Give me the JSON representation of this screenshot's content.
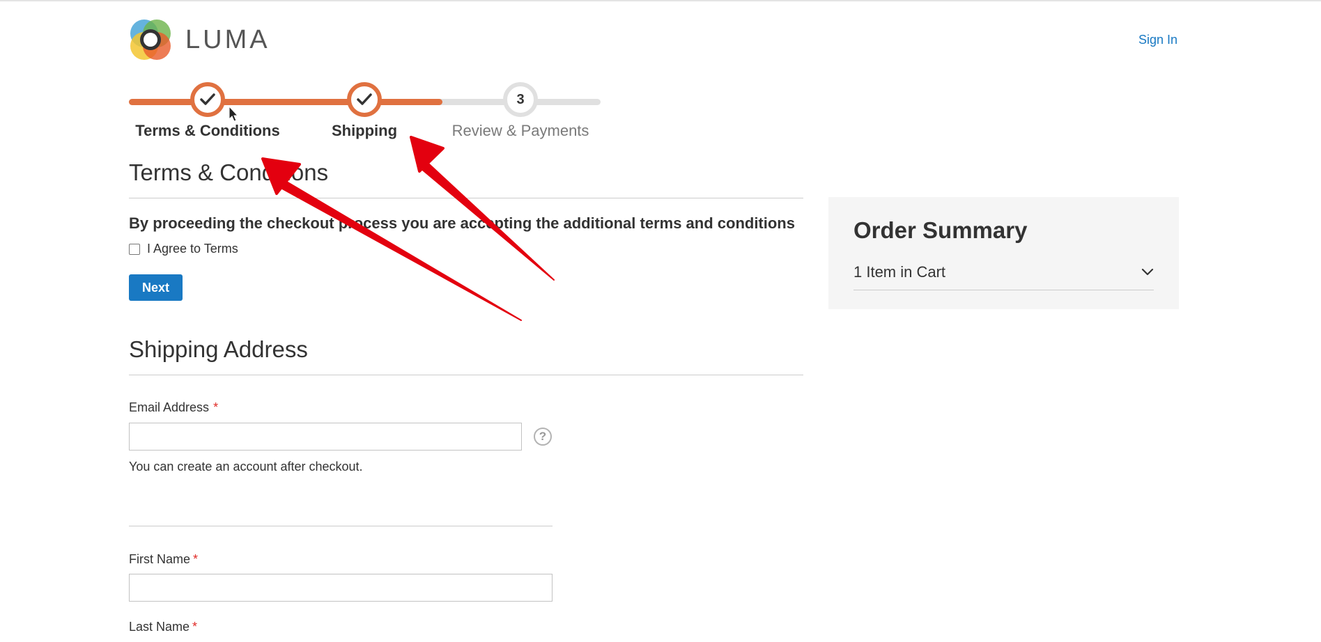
{
  "header": {
    "logo_text": "LUMA",
    "sign_in_label": "Sign In"
  },
  "progress": {
    "steps": [
      {
        "label": "Terms & Conditions",
        "status": "complete",
        "icon": "check-icon"
      },
      {
        "label": "Shipping",
        "status": "complete",
        "icon": "check-icon"
      },
      {
        "label": "Review & Payments",
        "status": "pending",
        "number": "3"
      }
    ]
  },
  "terms": {
    "title": "Terms & Conditions",
    "text": "By proceeding the checkout process you are accepting the additional terms and conditions",
    "checkbox_label": "I Agree to Terms",
    "checkbox_checked": false,
    "next_label": "Next"
  },
  "shipping": {
    "title": "Shipping Address",
    "email_label": "Email Address",
    "email_value": "",
    "email_note": "You can create an account after checkout.",
    "first_name_label": "First Name",
    "first_name_value": "",
    "last_name_label": "Last Name",
    "required_marker": "*",
    "help_icon": "question-circle-icon",
    "help_glyph": "?"
  },
  "summary": {
    "title": "Order Summary",
    "item_count": "1 Item in Cart",
    "expand_icon": "chevron-down-icon"
  },
  "colors": {
    "accent": "#e07140",
    "link": "#1979c3",
    "button": "#1979c3",
    "annotation_arrow": "#e3000f",
    "required": "#e02b27"
  }
}
